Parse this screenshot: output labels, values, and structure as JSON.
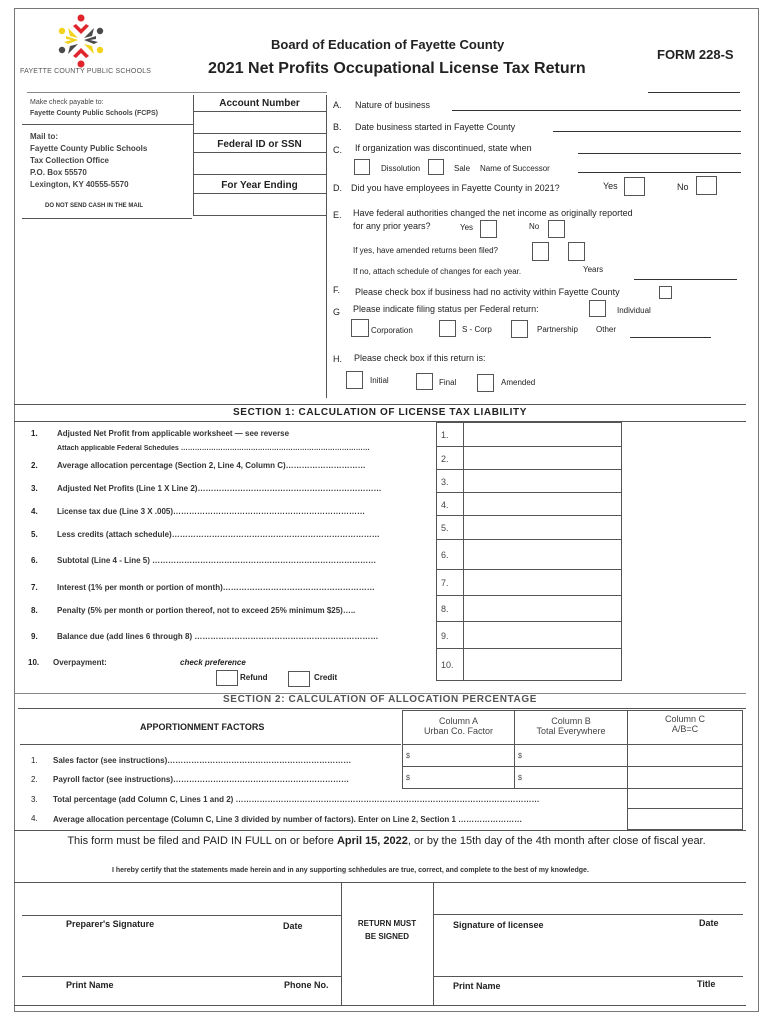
{
  "header": {
    "logo_caption": "FAYETTE COUNTY PUBLIC SCHOOLS",
    "board": "Board of Education of Fayette County",
    "title": "2021 Net Profits Occupational License Tax Return",
    "form_id": "FORM 228-S"
  },
  "payable": {
    "line1": "Make check payable to:",
    "line2": "Fayette County Public Schools (FCPS)"
  },
  "mail": {
    "lines": [
      "Mail to:",
      "Fayette County Public Schools",
      "Tax Collection Office",
      "P.O. Box 55570",
      "Lexington, KY 40555-5570"
    ],
    "cash_notice": "DO NOT SEND CASH IN THE MAIL"
  },
  "id_fields": {
    "account_number": "Account Number",
    "federal_id": "Federal ID or SSN",
    "year_ending": "For Year Ending"
  },
  "questions": {
    "a": {
      "letter": "A.",
      "text": "Nature of business"
    },
    "b": {
      "letter": "B.",
      "text": "Date business started in Fayette County"
    },
    "c": {
      "letter": "C.",
      "text": "If organization was discontinued, state when",
      "dissolution": "Dissolution",
      "sale": "Sale",
      "successor": "Name of Successor"
    },
    "d": {
      "letter": "D.",
      "text": "Did you have employees in Fayette County in 2021?",
      "yes": "Yes",
      "no": "No"
    },
    "e": {
      "letter": "E.",
      "text1": "Have federal authorities changed the net income as originally reported",
      "text2": "for any prior years?",
      "yes": "Yes",
      "no": "No",
      "amended": "If yes, have amended returns been filed?",
      "attach": "If no, attach schedule of changes for each year.",
      "years": "Years"
    },
    "f": {
      "letter": "F.",
      "text": "Please check box if business had no activity within Fayette County"
    },
    "g": {
      "letter": "G",
      "text": "Please indicate filing status per Federal return:",
      "individual": "Individual",
      "corporation": "Corporation",
      "scorp": "S - Corp",
      "partnership": "Partnership",
      "other": "Other"
    },
    "h": {
      "letter": "H.",
      "text": "Please check box if this return is:",
      "initial": "Initial",
      "final": "Final",
      "amended": "Amended"
    }
  },
  "section1": {
    "title": "SECTION 1:  CALCULATION  OF LICENSE TAX LIABILITY",
    "lines": [
      {
        "num": "1.",
        "text": "Adjusted Net Profit from applicable worksheet — see reverse",
        "box": "1."
      },
      {
        "num": "",
        "text": "Attach applicable Federal Schedules ………………………………………………………………………",
        "box": "2."
      },
      {
        "num": "2.",
        "text": "Average allocation percentage (Section 2, Line 4, Column C)…………………………",
        "box": ""
      },
      {
        "num": "3.",
        "text": "Adjusted Net Profits (Line 1 X Line 2)……………………………………………………………",
        "box": "3."
      },
      {
        "num": "4.",
        "text": "License tax due (Line 3 X .005)………………………………………………………………",
        "box": "4."
      },
      {
        "num": "5.",
        "text": "Less credits  (attach schedule)……………………………………………………………………",
        "box": "5."
      },
      {
        "num": "6.",
        "text": "Subtotal (Line 4 - Line 5) …………………………………………………………………………",
        "box": "6."
      },
      {
        "num": "7.",
        "text": "Interest (1% per month or portion of month)…………………………………………………",
        "box": "7."
      },
      {
        "num": "8.",
        "text": "Penalty (5% per month or portion thereof, not to exceed 25% minimum $25)…..",
        "box": "8."
      },
      {
        "num": "9.",
        "text": "Balance due (add lines 6 through 8) ……………………………………………………………",
        "box": "9."
      },
      {
        "num": "10.",
        "text": "Overpayment:",
        "box": "10."
      }
    ],
    "check_preference": "check preference",
    "refund": "Refund",
    "credit": "Credit"
  },
  "section2": {
    "title": "SECTION 2: CALCULATION  OF  ALLOCATION  PERCENTAGE",
    "factors_header": "APPORTIONMENT FACTORS",
    "col_a": [
      "Column A",
      "Urban Co. Factor"
    ],
    "col_b": [
      "Column B",
      "Total Everywhere"
    ],
    "col_c": [
      "Column C",
      "A/B=C"
    ],
    "currency": "$",
    "rows": [
      {
        "num": "1.",
        "text": "Sales factor (see instructions)……………………………………………………………"
      },
      {
        "num": "2.",
        "text": "Payroll factor (see instructions)…………………………………………………………"
      },
      {
        "num": "3.",
        "text": "Total percentage (add Column C, Lines 1 and 2) ……………………………………………………………………………………………………"
      },
      {
        "num": "4.",
        "text": "Average allocation percentage (Column C, Line 3 divided by number of factors). Enter on Line 2, Section 1 ……………………"
      }
    ]
  },
  "notice": {
    "pre": "This form must be filed and PAID IN FULL on or before ",
    "date": "April 15, 2022",
    "post": ", or by the 15th day of the 4th month after close of fiscal year.",
    "certify": "I hereby certify that the statements made herein and in any supporting schhedules are true, correct, and complete to the best of my knowledge."
  },
  "signatures": {
    "preparer": "Preparer's Signature",
    "date": "Date",
    "print_name": "Print Name",
    "phone": "Phone No.",
    "must_sign": [
      "RETURN MUST",
      "BE SIGNED"
    ],
    "licensee": "Signature of licensee",
    "title": "Title"
  },
  "colors": {
    "logo_red": "#e0242b",
    "logo_yellow": "#f2d31b",
    "logo_gray": "#4a4a4a"
  }
}
